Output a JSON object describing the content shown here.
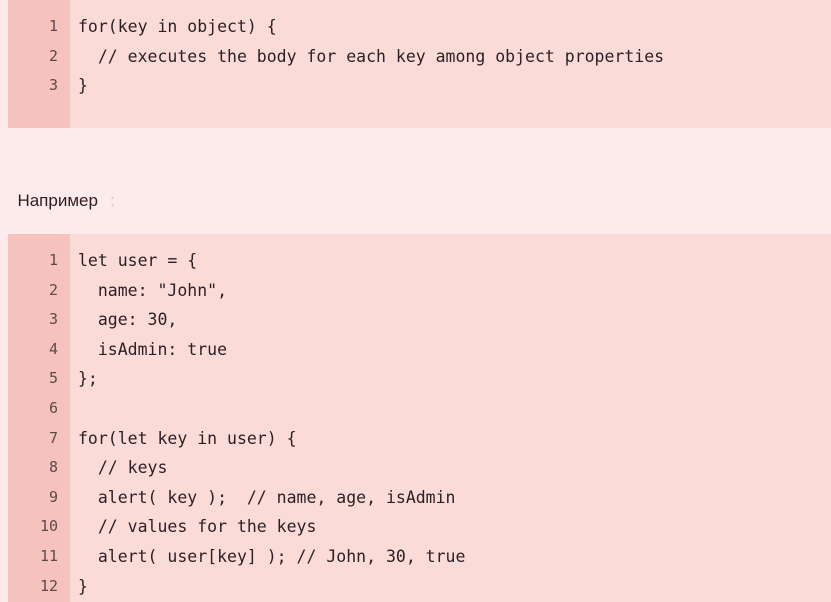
{
  "page": {
    "background_color": "#fdeaea",
    "code_block_background": "#fadbd8",
    "gutter_background": "#f5c2bd",
    "text_color": "#2b1f24",
    "line_number_color": "#5c4a4a"
  },
  "code_blocks": [
    {
      "id": "code-block-syntax",
      "language": "javascript",
      "line_numbers": [
        "1",
        "2",
        "3"
      ],
      "lines": [
        "for(key in object) {",
        "  // executes the body for each key among object properties",
        "}"
      ]
    },
    {
      "id": "code-block-example",
      "language": "javascript",
      "line_numbers": [
        "1",
        "2",
        "3",
        "4",
        "5",
        "6",
        "7",
        "8",
        "9",
        "10",
        "11",
        "12"
      ],
      "lines": [
        "let user = {",
        "  name: \"John\",",
        "  age: 30,",
        "  isAdmin: true",
        "};",
        "",
        "for(let key in user) {",
        "  // keys",
        "  alert( key );  // name, age, isAdmin",
        "  // values for the keys",
        "  alert( user[key] ); // John, 30, true",
        "}"
      ]
    }
  ],
  "paragraph": {
    "text": "Например",
    "trailing_mark": ":"
  }
}
